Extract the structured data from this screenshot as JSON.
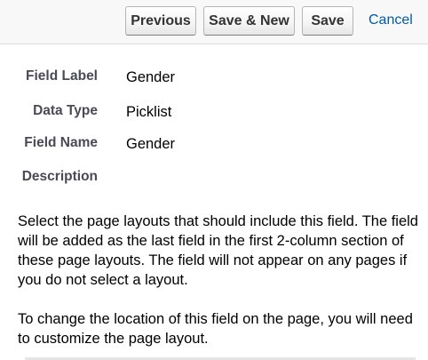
{
  "toolbar": {
    "previous_label": "Previous",
    "save_new_label": "Save & New",
    "save_label": "Save",
    "cancel_label": "Cancel"
  },
  "details": {
    "field_label": {
      "label": "Field Label",
      "value": "Gender"
    },
    "data_type": {
      "label": "Data Type",
      "value": "Picklist"
    },
    "field_name": {
      "label": "Field Name",
      "value": "Gender"
    },
    "description": {
      "label": "Description",
      "value": ""
    }
  },
  "instructions": {
    "paragraph1": "Select the page layouts that should include this field. The field will be added as the last field in the first 2-column section of these page layouts. The field will not appear on any pages if you do not select a layout.",
    "paragraph2": "To change the location of this field on the page, you will need to customize the page layout."
  },
  "colors": {
    "link": "#015ba7",
    "label": "#4a4a56"
  }
}
